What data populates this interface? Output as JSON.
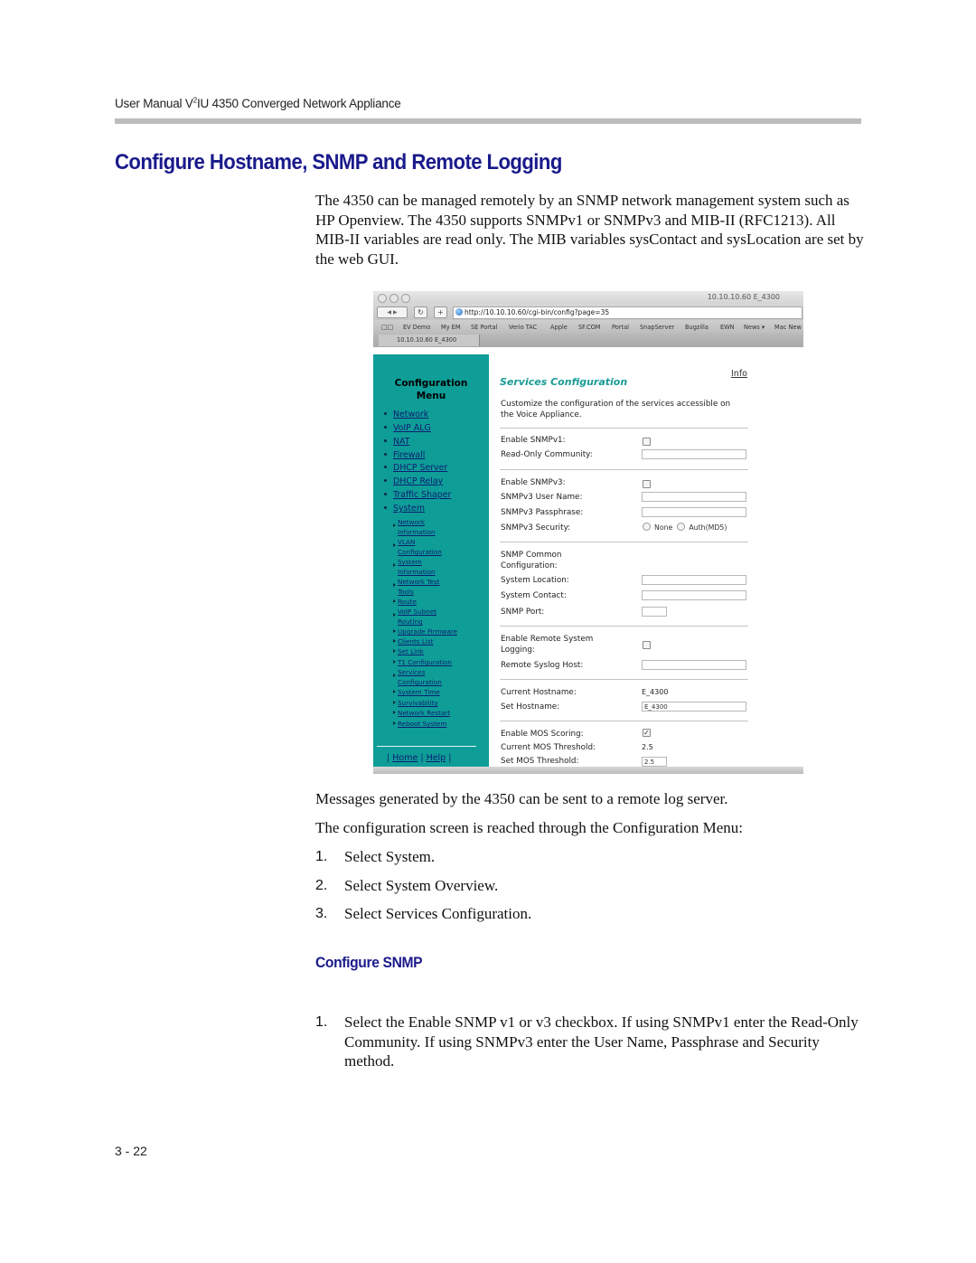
{
  "page": {
    "running_header": {
      "prefix": "User Manual V",
      "sup": "2",
      "suffix": "IU 4350 Converged Network Appliance"
    },
    "section_title": "Configure Hostname, SNMP and Remote Logging",
    "intro": "The 4350 can be managed remotely by an SNMP network management system such as HP Openview. The 4350 supports SNMPv1 or SNMPv3 and MIB-II (RFC1213). All MIB-II variables are read only. The MIB variables sysContact and sysLocation are set by the web GUI.",
    "para_messages": "Messages generated by the 4350 can be sent to a remote log server.",
    "para_reach": "The configuration screen is reached through the Configuration Menu:",
    "steps": [
      {
        "num": "1.",
        "text": "Select System."
      },
      {
        "num": "2.",
        "text": "Select System Overview."
      },
      {
        "num": "3.",
        "text": "Select Services Configuration."
      }
    ],
    "subsection_title": "Configure SNMP",
    "snmp_steps": [
      {
        "num": "1.",
        "text": "Select the Enable SNMP v1 or v3 checkbox. If using SNMPv1 enter the Read-Only Community. If using SNMPv3 enter the User Name, Passphrase and Security method."
      }
    ],
    "page_number": "3 - 22"
  },
  "browser": {
    "window_title": "10.10.10.60 E_4300",
    "url": "http://10.10.10.60/cgi-bin/config?page=35",
    "reload_icon": "↻",
    "add_icon": "+",
    "back_forward": "◀ ▶",
    "bookmarks_icon": "📖",
    "bookmarks": [
      "EV Demo",
      "My EM",
      "SE Portal",
      "Verio TAC",
      "Apple",
      "SF.COM",
      "Portal",
      "SnapServer",
      "Bugzilla",
      "EWN",
      "News ▾",
      "Mac New"
    ],
    "tab_label": "10.10.10.60 E_4300"
  },
  "config_menu": {
    "title_line1": "Configuration",
    "title_line2": "Menu",
    "items": [
      "Network",
      "VoIP ALG",
      "NAT",
      "Firewall",
      "DHCP Server",
      "DHCP Relay",
      "Traffic Shaper",
      "System"
    ],
    "system_subitems": [
      [
        "Network",
        "Information"
      ],
      [
        "VLAN",
        "Configuration"
      ],
      [
        "System",
        "Information"
      ],
      [
        "Network Test",
        "Tools"
      ],
      [
        "Route"
      ],
      [
        "VoIP Subnet",
        "Routing"
      ],
      [
        "Upgrade Firmware"
      ],
      [
        "Clients List"
      ],
      [
        "Set Link"
      ],
      [
        "T1 Configuration"
      ],
      [
        "Services",
        "Configuration"
      ],
      [
        "System Time"
      ],
      [
        "Survivability"
      ],
      [
        "Network Restart"
      ],
      [
        "Reboot System"
      ]
    ],
    "footer": {
      "sep": "|",
      "home": "Home",
      "help": "Help"
    }
  },
  "services": {
    "title": "Services Configuration",
    "info_link": "Info",
    "description": "Customize the configuration of the services accessible on the Voice Appliance.",
    "enable_snmpv1": {
      "label": "Enable SNMPv1:",
      "checked": false
    },
    "ro_community": {
      "label": "Read-Only Community:",
      "value": ""
    },
    "enable_snmpv3": {
      "label": "Enable SNMPv3:",
      "checked": false
    },
    "v3_user": {
      "label": "SNMPv3 User Name:",
      "value": ""
    },
    "v3_pass": {
      "label": "SNMPv3 Passphrase:",
      "value": ""
    },
    "v3_security": {
      "label": "SNMPv3 Security:",
      "options": [
        "None",
        "Auth(MD5)"
      ]
    },
    "common_label_1": "SNMP Common",
    "common_label_2": "Configuration:",
    "sys_location": {
      "label": "System Location:",
      "value": ""
    },
    "sys_contact": {
      "label": "System Contact:",
      "value": ""
    },
    "snmp_port": {
      "label": "SNMP Port:",
      "value": ""
    },
    "remote_logging_1": "Enable Remote System",
    "remote_logging_2": "Logging:",
    "remote_logging_checked": false,
    "syslog_host": {
      "label": "Remote Syslog Host:",
      "value": ""
    },
    "current_hostname": {
      "label": "Current Hostname:",
      "value": "E_4300"
    },
    "set_hostname": {
      "label": "Set Hostname:",
      "value": "E_4300"
    },
    "mos_scoring": {
      "label": "Enable MOS Scoring:",
      "checked": true,
      "mark": "✓"
    },
    "current_mos": {
      "label": "Current MOS Threshold:",
      "value": "2.5"
    },
    "set_mos": {
      "label": "Set MOS Threshold:",
      "value": "2.5"
    }
  },
  "colors": {
    "heading_blue": "#1a1a8c",
    "menu_teal": "#0f9d98",
    "services_title_teal": "#1a9b96",
    "header_rule_gray": "#bdbdbd"
  }
}
